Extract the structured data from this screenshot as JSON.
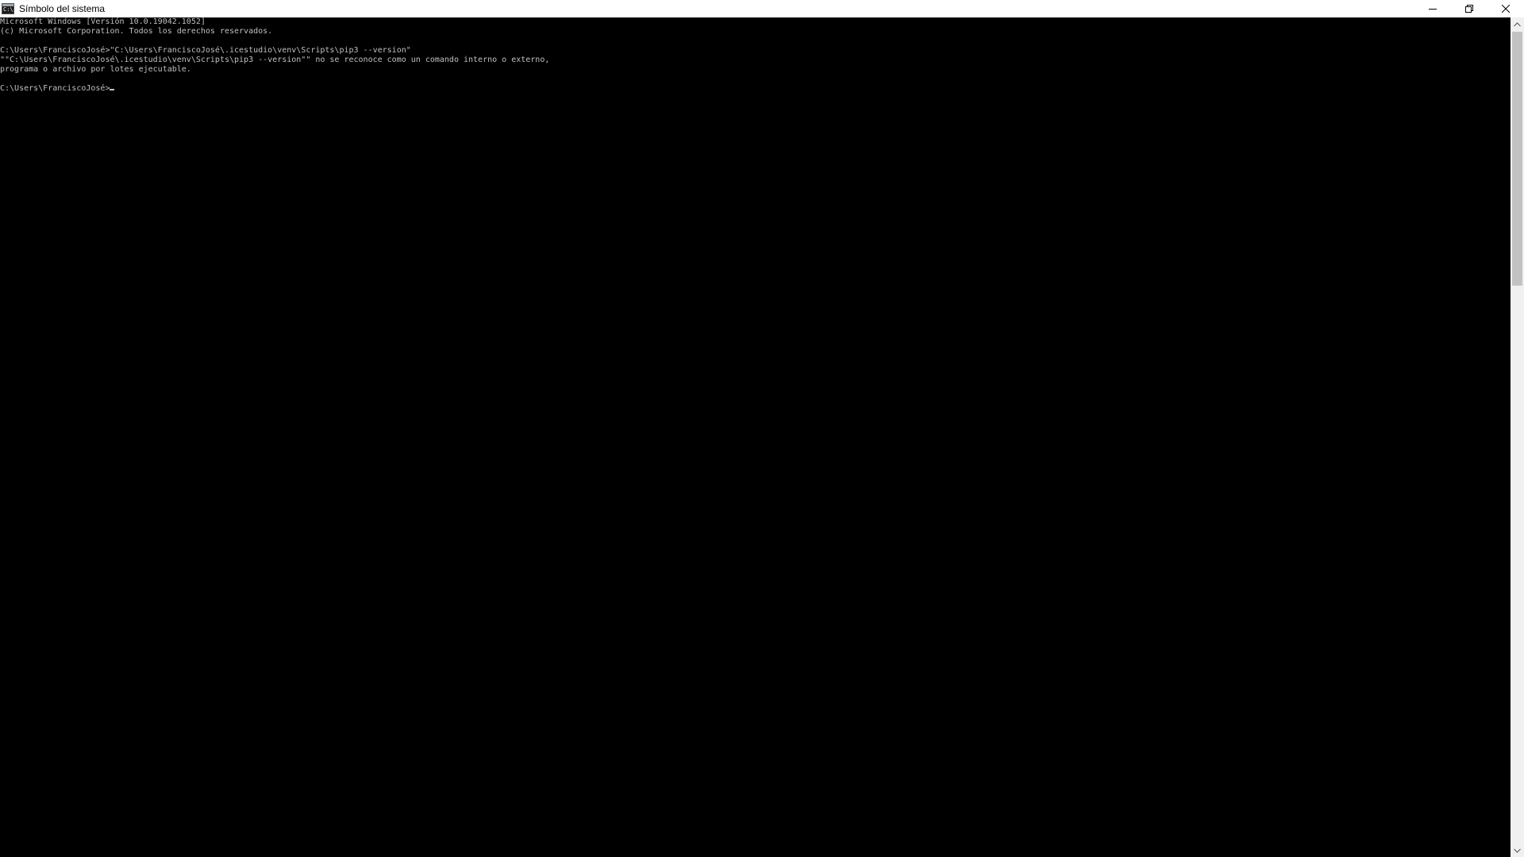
{
  "window": {
    "title": "Símbolo del sistema",
    "icon": "cmd-icon",
    "controls": [
      "minimize-icon",
      "restore-icon",
      "close-icon"
    ]
  },
  "terminal": {
    "background": "#000000",
    "foreground": "#c0c0c0",
    "lines": [
      "Microsoft Windows [Versión 10.0.19042.1052]",
      "(c) Microsoft Corporation. Todos los derechos reservados.",
      "",
      "C:\\Users\\FranciscoJosé>\"C:\\Users\\FranciscoJosé\\.icestudio\\venv\\Scripts\\pip3 --version\"",
      "\"\"C:\\Users\\FranciscoJosé\\.icestudio\\venv\\Scripts\\pip3 --version\"\" no se reconoce como un comando interno o externo,",
      "programa o archivo por lotes ejecutable.",
      "",
      "C:\\Users\\FranciscoJosé>"
    ]
  },
  "scrollbar": {
    "up_icon": "scroll-up-arrow-icon",
    "down_icon": "scroll-down-arrow-icon"
  }
}
